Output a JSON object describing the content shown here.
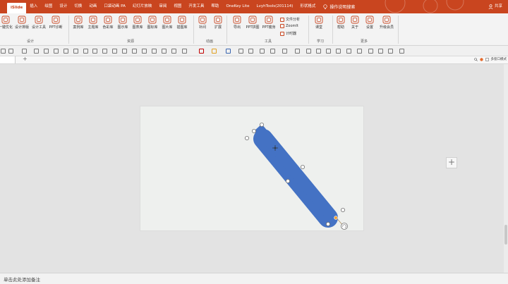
{
  "tabs": [
    "iSlide",
    "插入",
    "绘图",
    "设计",
    "切换",
    "动画",
    "口袋动画 PA",
    "幻灯片放映",
    "审阅",
    "视图",
    "开发工具",
    "帮助",
    "OneKey Lite",
    "LvyhTools(201114)",
    "形状格式"
  ],
  "search_text": "操作说明搜索",
  "share_label": "共享",
  "ribbon": {
    "buttons": [
      {
        "label": "一键优化"
      },
      {
        "label": "设计排版"
      },
      {
        "label": "设计工具"
      },
      {
        "label": "PPT诊断"
      },
      {
        "label": "案例库"
      },
      {
        "label": "主题库"
      },
      {
        "label": "色彩库"
      },
      {
        "label": "图示库"
      },
      {
        "label": "图表库"
      },
      {
        "label": "图标库"
      },
      {
        "label": "图片库"
      },
      {
        "label": "插图库"
      },
      {
        "label": "补间"
      },
      {
        "label": "扩展"
      },
      {
        "label": "导出"
      },
      {
        "label": "PPT拼图"
      },
      {
        "label": "PPT瘦身"
      },
      {
        "label": "课堂"
      },
      {
        "label": "帮助"
      },
      {
        "label": "关于"
      },
      {
        "label": "设置"
      },
      {
        "label": "升级会员"
      }
    ],
    "small_buttons": [
      "文件分析",
      "ZoomIt",
      "计时器"
    ],
    "groups": [
      "设计",
      "资源",
      "动画",
      "工具",
      "学习",
      "更多"
    ]
  },
  "right_tools": "多窗口模式",
  "notes_placeholder": "单击此处添加备注",
  "colors": {
    "accent": "#c9451f",
    "shape_fill": "#4472c4"
  },
  "icons": [
    "plus-icon",
    "lightbulb-icon",
    "user-icon",
    "rotate-handle-icon",
    "zoom-icon"
  ]
}
